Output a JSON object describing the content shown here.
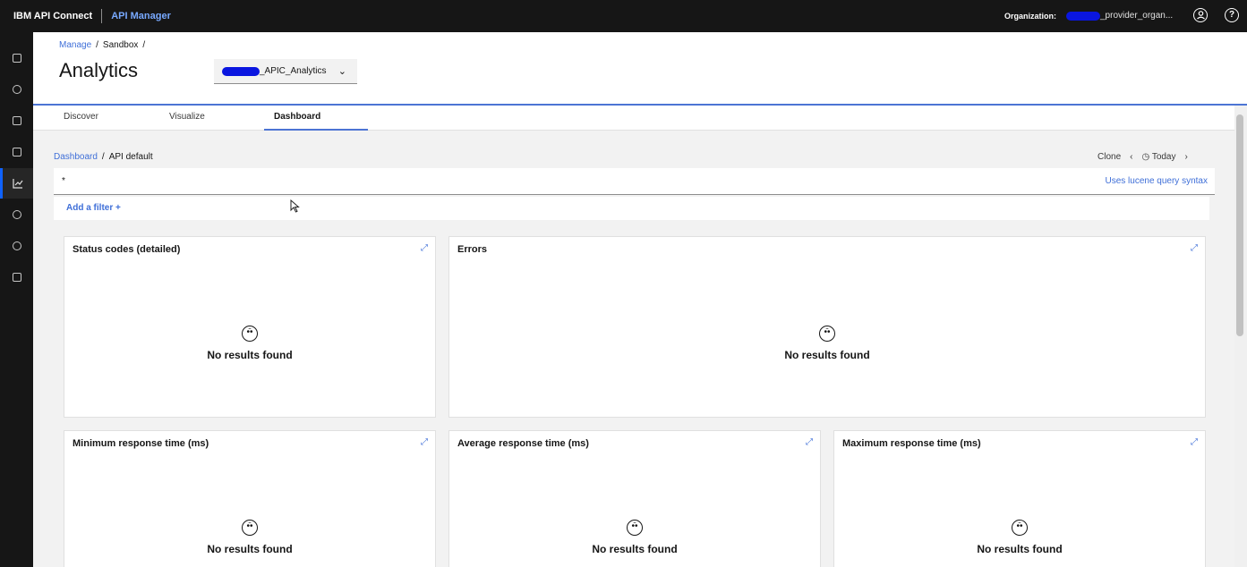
{
  "topbar": {
    "brand": "IBM API Connect",
    "product": "API Manager",
    "org_label": "Organization:",
    "org_name": "_provider_organ..."
  },
  "sidebar": {
    "active_index": 4
  },
  "header": {
    "breadcrumb": [
      "Manage",
      "Sandbox"
    ],
    "title": "Analytics",
    "dataset_selector": "_APIC_Analytics"
  },
  "tabs": [
    "Discover",
    "Visualize",
    "Dashboard"
  ],
  "active_tab": "Dashboard",
  "dashboard": {
    "breadcrumb_root": "Dashboard",
    "breadcrumb_current": "API default",
    "clone_label": "Clone",
    "time_range": "Today",
    "query_value": "*",
    "query_hint": "Uses lucene query syntax",
    "add_filter": "Add a filter"
  },
  "panels": [
    {
      "title": "Status codes (detailed)",
      "empty_text": "No results found"
    },
    {
      "title": "Errors",
      "empty_text": "No results found"
    },
    {
      "title": "Minimum response time (ms)",
      "empty_text": "No results found"
    },
    {
      "title": "Average response time (ms)",
      "empty_text": "No results found"
    },
    {
      "title": "Maximum response time (ms)",
      "empty_text": "No results found"
    }
  ]
}
